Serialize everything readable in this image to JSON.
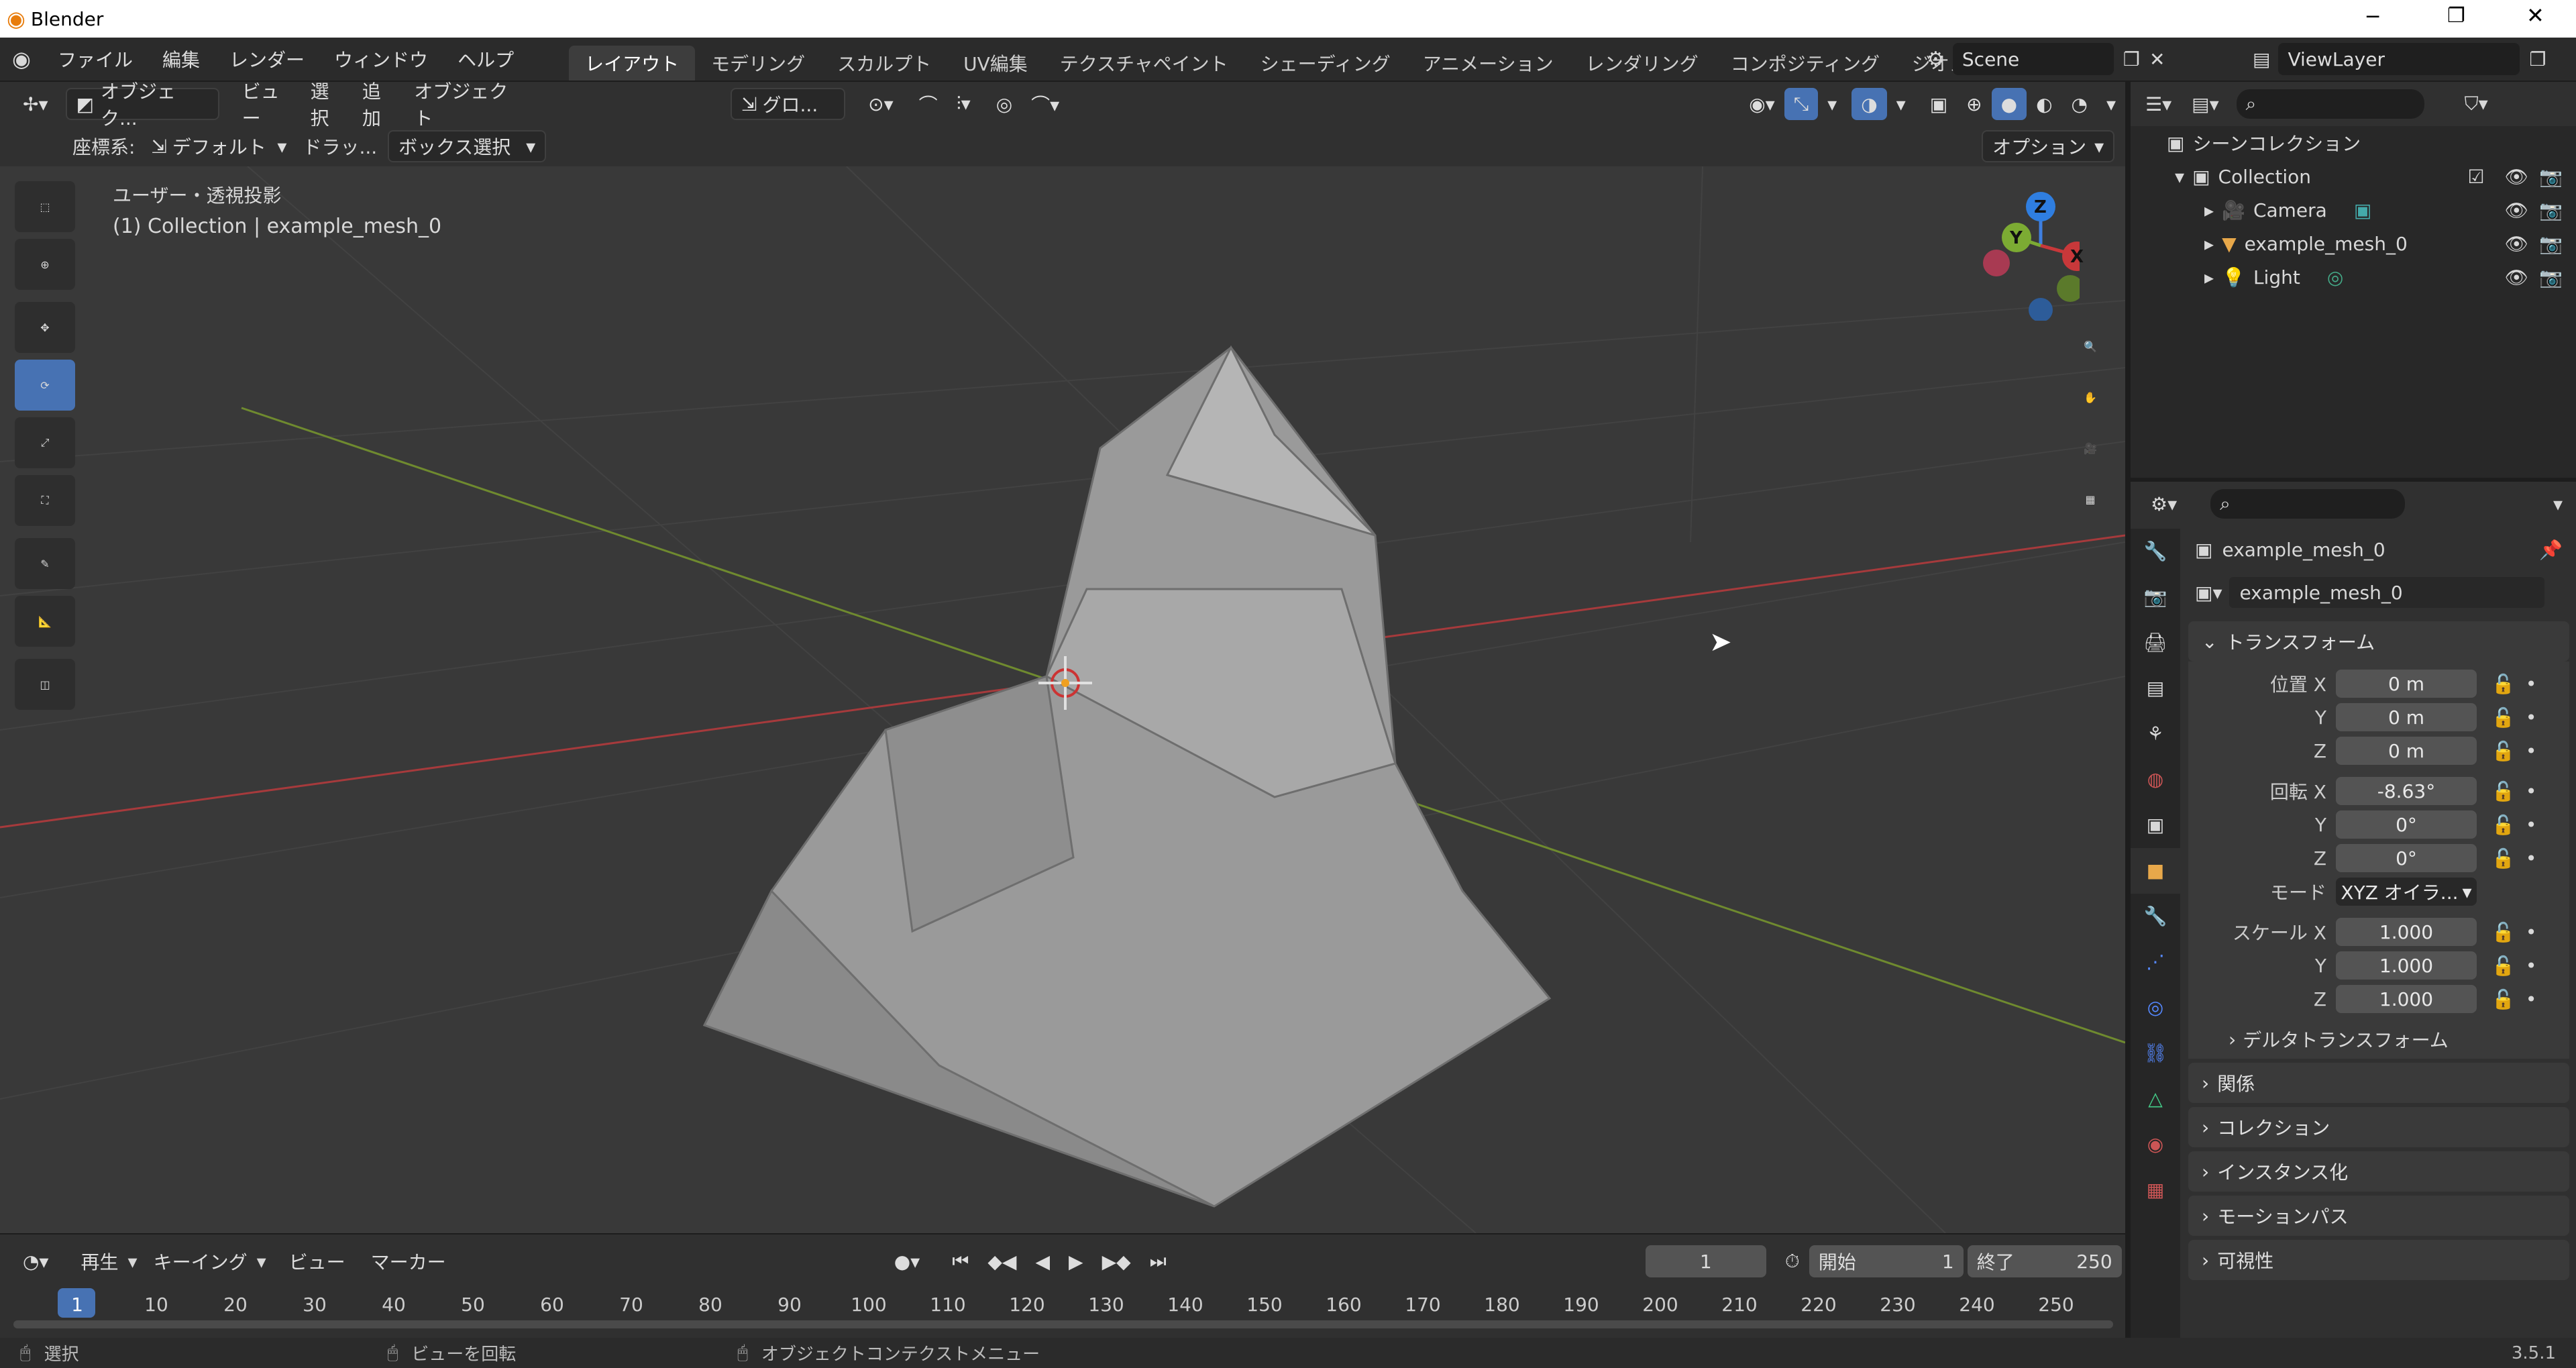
{
  "titlebar": {
    "app_title": "Blender"
  },
  "menubar": {
    "menus": [
      "ファイル",
      "編集",
      "レンダー",
      "ウィンドウ",
      "ヘルプ"
    ],
    "workspaces": [
      "レイアウト",
      "モデリング",
      "スカルプト",
      "UV編集",
      "テクスチャペイント",
      "シェーディング",
      "アニメーション",
      "レンダリング",
      "コンポジティング",
      "ジオメト"
    ],
    "scene": "Scene",
    "view_layer": "ViewLayer"
  },
  "viewport_header": {
    "mode": "オブジェク...",
    "menus": [
      "ビュー",
      "選択",
      "追加",
      "オブジェクト"
    ],
    "transform_orientation": "グロ...",
    "coord_label": "座標系:",
    "coord_value": "デフォルト",
    "drag_label": "ドラッ...",
    "drag_value": "ボックス選択",
    "options": "オプション"
  },
  "viewport": {
    "view_name": "ユーザー・透視投影",
    "collection_info": "(1) Collection | example_mesh_0",
    "gizmo": {
      "z": "Z",
      "y": "Y",
      "x": "X"
    }
  },
  "outliner": {
    "root": "シーンコレクション",
    "collection": "Collection",
    "items": [
      "Camera",
      "example_mesh_0",
      "Light"
    ]
  },
  "properties": {
    "object_name": "example_mesh_0",
    "datablock": "example_mesh_0",
    "transform": "トランスフォーム",
    "location_label": "位置 X",
    "rotation_label": "回転 X",
    "scale_label": "スケール X",
    "y": "Y",
    "z": "Z",
    "location": [
      "0 m",
      "0 m",
      "0 m"
    ],
    "rotation": [
      "-8.63°",
      "0°",
      "0°"
    ],
    "mode_label": "モード",
    "mode_value": "XYZ オイラ...",
    "scale": [
      "1.000",
      "1.000",
      "1.000"
    ],
    "delta": "デルタトランスフォーム",
    "sections": [
      "関係",
      "コレクション",
      "インスタンス化",
      "モーションパス",
      "可視性"
    ]
  },
  "timeline": {
    "menus": [
      "再生",
      "キーイング",
      "ビュー",
      "マーカー"
    ],
    "current_frame": "1",
    "start_label": "開始",
    "start": "1",
    "end_label": "終了",
    "end": "250",
    "ticks": [
      "1",
      "10",
      "20",
      "30",
      "40",
      "50",
      "60",
      "70",
      "80",
      "90",
      "100",
      "110",
      "120",
      "130",
      "140",
      "150",
      "160",
      "170",
      "180",
      "190",
      "200",
      "210",
      "220",
      "230",
      "240",
      "250"
    ]
  },
  "statusbar": {
    "select": "選択",
    "rotate_view": "ビューを回転",
    "context_menu": "オブジェクトコンテクストメニュー",
    "version": "3.5.1"
  },
  "colors": {
    "accent": "#4772b3",
    "x_axis": "#c8383a",
    "y_axis": "#7cab33",
    "z_axis": "#2f7ee0"
  }
}
